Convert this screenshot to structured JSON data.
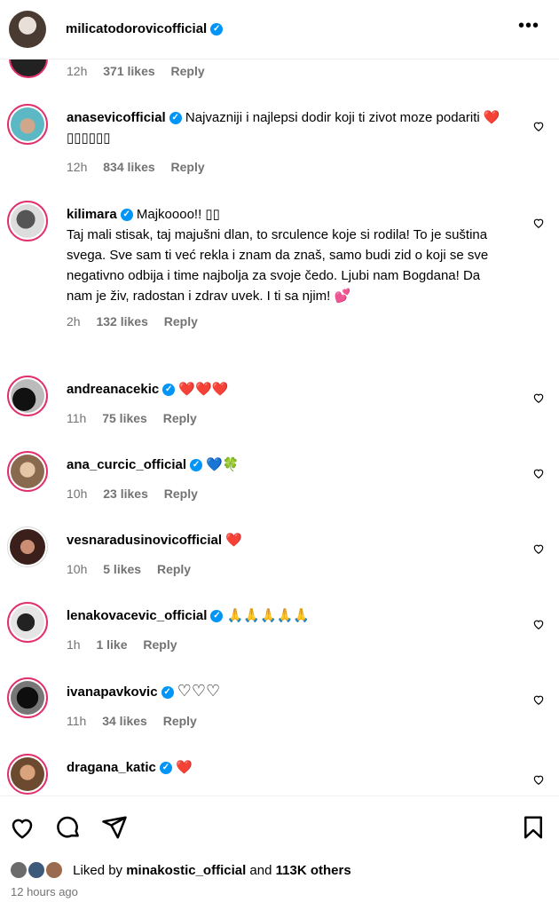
{
  "header": {
    "username": "milicatodorovicofficial",
    "more_label": "•••"
  },
  "top_partial": {
    "time": "12h",
    "likes": "371 likes",
    "reply": "Reply"
  },
  "comments": [
    {
      "user": "anasevicofficial",
      "text": "Najvazniji i najlepsi dodir koji ti zivot moze podariti",
      "emoji": "❤️",
      "trailing": "▯▯▯▯▯▯",
      "time": "12h",
      "likes": "834 likes",
      "reply": "Reply"
    },
    {
      "user": "kilimara",
      "text": "Majkoooo!! ▯▯\nTaj mali stisak, taj majušni dlan, to srculence koje si rodila! To je suština svega. Sve sam ti već rekla i znam da znaš, samo budi zid o koji se sve negativno odbija i time najbolja za svoje čedo. Ljubi nam Bogdana! Da nam je živ, radostan i zdrav uvek. I ti sa njim!",
      "emoji": "💕",
      "time": "2h",
      "likes": "132 likes",
      "reply": "Reply"
    },
    {
      "user": "andreanacekic",
      "text": "",
      "emoji": "❤️❤️❤️",
      "time": "11h",
      "likes": "75 likes",
      "reply": "Reply"
    },
    {
      "user": "ana_curcic_official",
      "text": "",
      "emoji": "💙🍀",
      "time": "10h",
      "likes": "23 likes",
      "reply": "Reply"
    },
    {
      "user": "vesnaradusinovicofficial",
      "text": "",
      "emoji": "❤️",
      "time": "10h",
      "likes": "5 likes",
      "reply": "Reply"
    },
    {
      "user": "lenakovacevic_official",
      "text": "",
      "emoji": "🙏🙏🙏🙏🙏",
      "time": "1h",
      "likes": "1 like",
      "reply": "Reply"
    },
    {
      "user": "ivanapavkovic",
      "text": "",
      "emoji": "♡♡♡",
      "time": "11h",
      "likes": "34 likes",
      "reply": "Reply"
    },
    {
      "user": "dragana_katic",
      "text": "",
      "emoji": "❤️",
      "time": "",
      "likes": "",
      "reply": ""
    }
  ],
  "footer": {
    "liked_prefix": "Liked by ",
    "liked_user": "minakostic_official",
    "liked_mid": " and ",
    "liked_count": "113K others",
    "time_ago": "12 hours ago"
  },
  "colors": {
    "accent": "#0095f6",
    "story_ring": "#e1306c",
    "heart": "#e0245e",
    "muted": "#737373"
  }
}
